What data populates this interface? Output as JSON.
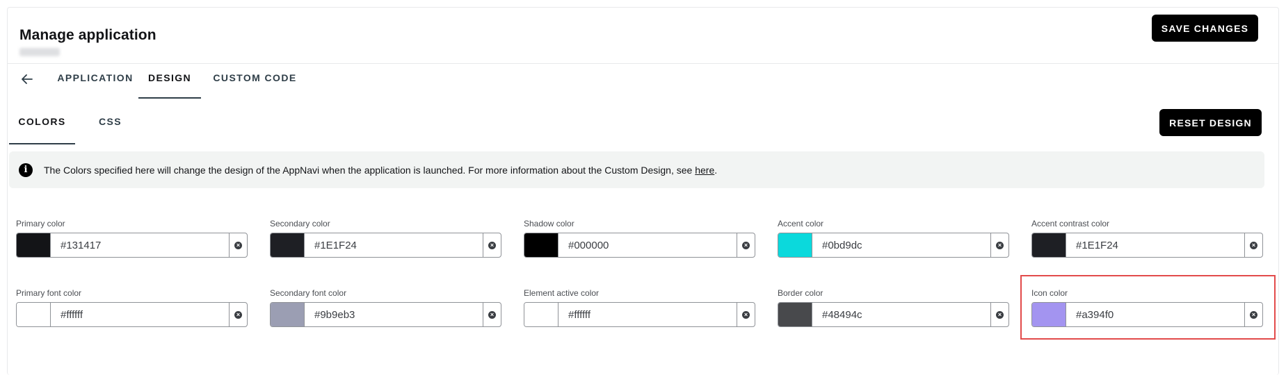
{
  "header": {
    "title": "Manage application",
    "save_label": "SAVE CHANGES"
  },
  "tabs": [
    {
      "label": "APPLICATION",
      "active": false
    },
    {
      "label": "DESIGN",
      "active": true
    },
    {
      "label": "CUSTOM CODE",
      "active": false
    }
  ],
  "subtabs": [
    {
      "label": "COLORS",
      "active": true
    },
    {
      "label": "CSS",
      "active": false
    }
  ],
  "reset_label": "RESET DESIGN",
  "info": {
    "text": "The Colors specified here will change the design of the AppNavi when the application is launched. For more information about the Custom Design, see ",
    "link": "here",
    "suffix": "."
  },
  "fields": [
    {
      "label": "Primary color",
      "value": "#131417",
      "swatch": "#131417"
    },
    {
      "label": "Secondary color",
      "value": "#1E1F24",
      "swatch": "#1E1F24"
    },
    {
      "label": "Shadow color",
      "value": "#000000",
      "swatch": "#000000"
    },
    {
      "label": "Accent color",
      "value": "#0bd9dc",
      "swatch": "#0bd9dc"
    },
    {
      "label": "Accent contrast color",
      "value": "#1E1F24",
      "swatch": "#1E1F24"
    },
    {
      "label": "Primary font color",
      "value": "#ffffff",
      "swatch": "#ffffff"
    },
    {
      "label": "Secondary font color",
      "value": "#9b9eb3",
      "swatch": "#9b9eb3"
    },
    {
      "label": "Element active color",
      "value": "#ffffff",
      "swatch": "#ffffff"
    },
    {
      "label": "Border color",
      "value": "#48494c",
      "swatch": "#48494c"
    },
    {
      "label": "Icon color",
      "value": "#a394f0",
      "swatch": "#a394f0"
    }
  ],
  "icons": {
    "back": "arrow-left-icon",
    "info": "info-icon",
    "clear": "close-circle-icon"
  },
  "highlight_color": "#e24a4a"
}
